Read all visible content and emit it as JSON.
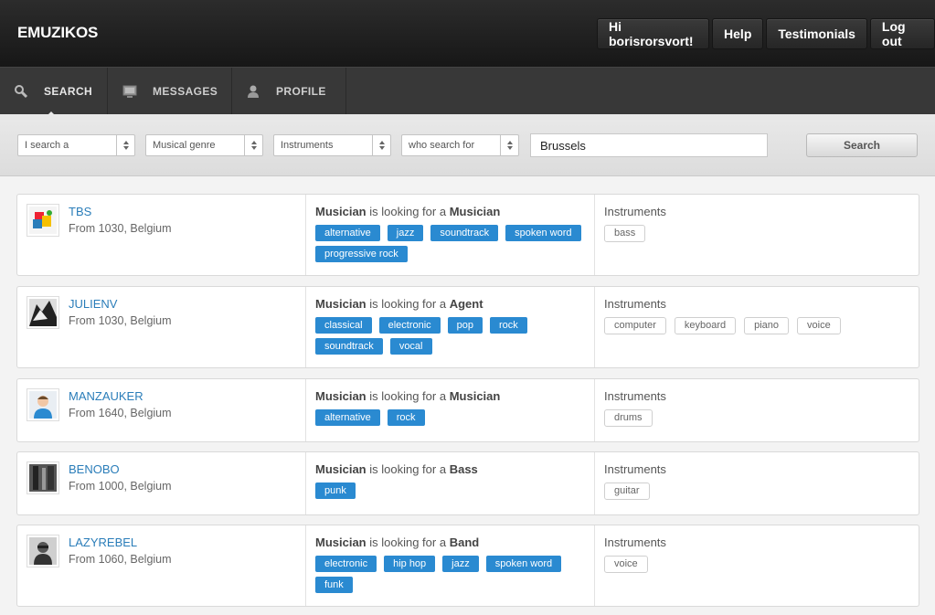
{
  "header": {
    "logo": "EMUZIKOS",
    "nav": [
      "Hi borisrorsvort!",
      "Help",
      "Testimonials",
      "Log out"
    ]
  },
  "tabs": [
    {
      "label": "SEARCH",
      "icon": "search-icon",
      "active": true
    },
    {
      "label": "MESSAGES",
      "icon": "monitor-icon",
      "active": false
    },
    {
      "label": "PROFILE",
      "icon": "user-icon",
      "active": false
    }
  ],
  "search": {
    "selects": [
      "I search a",
      "Musical genre",
      "Instruments",
      "who search for"
    ],
    "city_value": "Brussels",
    "button_label": "Search"
  },
  "common": {
    "looking_for": "is looking for a",
    "instruments_title": "Instruments"
  },
  "results": [
    {
      "name": "TBS",
      "location": "From 1030, Belgium",
      "who": "Musician",
      "target": "Musician",
      "genres": [
        "alternative",
        "jazz",
        "soundtrack",
        "spoken word",
        "progressive rock"
      ],
      "instruments": [
        "bass"
      ]
    },
    {
      "name": "JULIENV",
      "location": "From 1030, Belgium",
      "who": "Musician",
      "target": "Agent",
      "genres": [
        "classical",
        "electronic",
        "pop",
        "rock",
        "soundtrack",
        "vocal"
      ],
      "instruments": [
        "computer",
        "keyboard",
        "piano",
        "voice"
      ]
    },
    {
      "name": "MANZAUKER",
      "location": "From 1640, Belgium",
      "who": "Musician",
      "target": "Musician",
      "genres": [
        "alternative",
        "rock"
      ],
      "instruments": [
        "drums"
      ]
    },
    {
      "name": "BENOBO",
      "location": "From 1000, Belgium",
      "who": "Musician",
      "target": "Bass",
      "genres": [
        "punk"
      ],
      "instruments": [
        "guitar"
      ]
    },
    {
      "name": "LAZYREBEL",
      "location": "From 1060, Belgium",
      "who": "Musician",
      "target": "Band",
      "genres": [
        "electronic",
        "hip hop",
        "jazz",
        "spoken word",
        "funk"
      ],
      "instruments": [
        "voice"
      ]
    }
  ]
}
